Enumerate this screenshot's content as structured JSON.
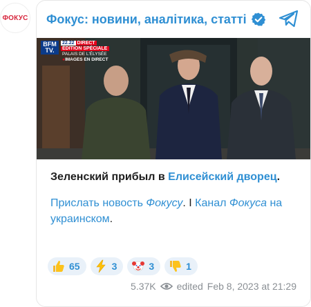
{
  "avatar": {
    "label": "ФОКУС"
  },
  "header": {
    "title": "Фокус: новини, аналітика, статті",
    "verified_icon": "verified-badge-icon",
    "share_icon": "telegram-share-icon"
  },
  "photo": {
    "tv": {
      "logo_line1": "BFM",
      "logo_line2": "TV.",
      "time": "22.22",
      "direct": "DIRECT",
      "special": "ÉDITION SPÉCIALE",
      "place": "PALAIS DE L'ÉLYSÉE",
      "images": "IMAGES EN DIRECT"
    }
  },
  "message": {
    "line1_main": "Зеленский прибыл в ",
    "line1_link": "Елисейский дворец",
    "line1_end": ".",
    "send_link": "Прислать новость ",
    "send_link_italic": "Фокусу",
    "separator": ". I ",
    "channel_link": "Канал",
    "channel_italic": "Фокуса",
    "channel_rest": " на украинском",
    "end": "."
  },
  "reactions": [
    {
      "emoji": "thumbs-up-icon",
      "count": "65"
    },
    {
      "emoji": "lightning-icon",
      "count": "3"
    },
    {
      "emoji": "clown-face-icon",
      "count": "3"
    },
    {
      "emoji": "thumbs-down-icon",
      "count": "1"
    }
  ],
  "footer": {
    "views": "5.37K",
    "edited": "edited",
    "date": "Feb 8, 2023 at 21:29"
  },
  "colors": {
    "accent": "#2f8fd3",
    "reaction_bg": "#e9f1f9",
    "meta": "#8a8f94",
    "brand_red": "#d7263d"
  }
}
